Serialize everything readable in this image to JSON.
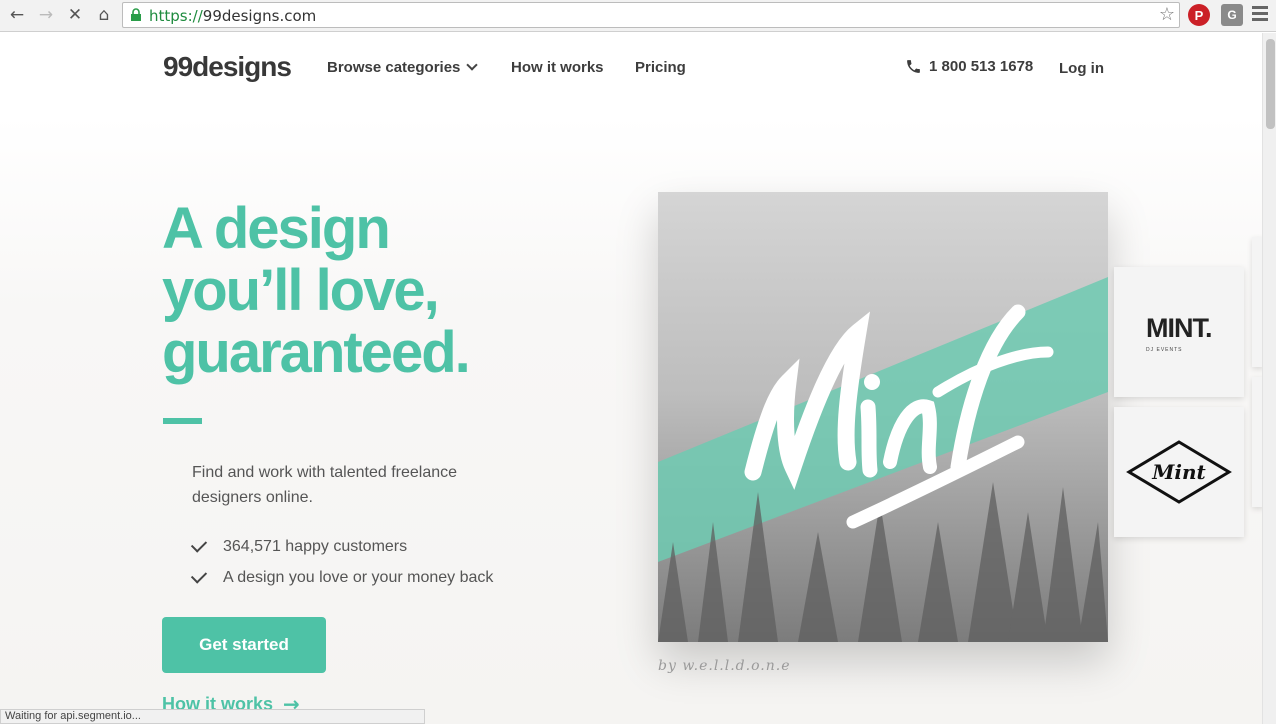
{
  "browser": {
    "url_scheme": "https://",
    "url_host": "99designs.com",
    "status_text": "Waiting for api.segment.io..."
  },
  "header": {
    "logo": "99designs",
    "nav": {
      "browse": "Browse categories",
      "how": "How it works",
      "pricing": "Pricing"
    },
    "phone": "1 800 513 1678",
    "login": "Log in"
  },
  "hero": {
    "title_lines": [
      "A design",
      "you’ll love,",
      "guaranteed."
    ],
    "subtitle": "Find and work with talented freelance designers online.",
    "bullets": [
      "364,571 happy customers",
      "A design you love or your money back"
    ],
    "cta": "Get started",
    "secondary_link": "How it works",
    "credit": "by w.e.l.l.d.o.n.e"
  },
  "thumbnails": {
    "first_mark": "MINT.",
    "first_sub": "DJ EVENTS",
    "second_mark": "Mint"
  },
  "colors": {
    "accent": "#4ec2a6",
    "text": "#3d3d3d"
  }
}
